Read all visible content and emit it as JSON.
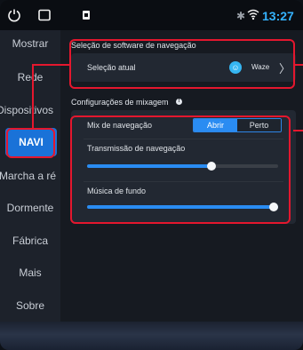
{
  "status_bar": {
    "time": "13:27",
    "icons": [
      "power-icon",
      "recent-apps-icon",
      "notification-icon",
      "bluetooth-icon",
      "wifi-icon"
    ]
  },
  "sidebar": {
    "items": [
      {
        "label": "Mostrar",
        "active": false
      },
      {
        "label": "Rede",
        "active": false
      },
      {
        "label": "Dispositivos",
        "active": false
      },
      {
        "label": "NAVI",
        "active": true
      },
      {
        "label": "Marcha a ré",
        "active": false
      },
      {
        "label": "Dormente",
        "active": false
      },
      {
        "label": "Fábrica",
        "active": false
      },
      {
        "label": "Mais",
        "active": false
      },
      {
        "label": "Sobre",
        "active": false
      }
    ]
  },
  "navigation_software": {
    "title": "Seleção de software de navegação",
    "current_label": "Seleção atual",
    "current_app": "Waze"
  },
  "mix_settings": {
    "title": "Configurações de mixagem",
    "mix_label": "Mix de navegação",
    "mix_options": [
      "Abrir",
      "Perto"
    ],
    "mix_selected": "Abrir",
    "nav_transmission_label": "Transmissão de navegação",
    "nav_transmission_level": 0.65,
    "background_music_label": "Música de fundo",
    "background_music_level": 1.0
  },
  "colors": {
    "accent": "#2a8cf2",
    "highlight": "#e4172e",
    "time": "#35b3ff",
    "waze": "#36b6f2"
  }
}
